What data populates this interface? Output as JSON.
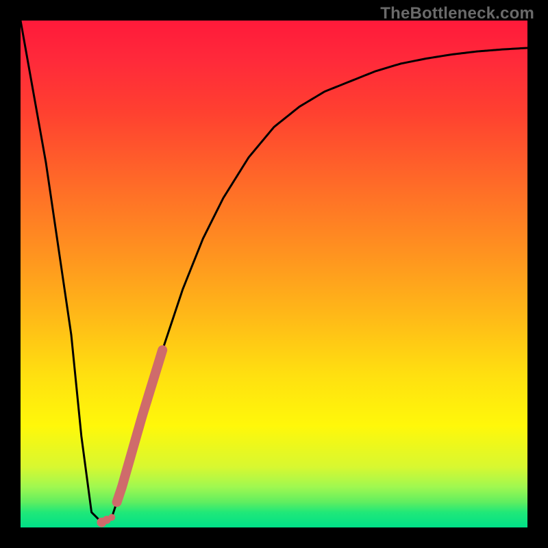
{
  "attribution": "TheBottleneck.com",
  "accent_colors": {
    "curve": "#000000",
    "marker": "#cf6b6b"
  },
  "chart_data": {
    "type": "line",
    "title": "",
    "xlabel": "",
    "ylabel": "",
    "xlim": [
      0,
      100
    ],
    "ylim": [
      0,
      100
    ],
    "series": [
      {
        "name": "bottleneck-curve",
        "x": [
          0,
          5,
          10,
          12,
          14,
          16,
          18,
          20,
          24,
          28,
          32,
          36,
          40,
          45,
          50,
          55,
          60,
          65,
          70,
          75,
          80,
          85,
          90,
          95,
          100
        ],
        "y": [
          100,
          72,
          38,
          18,
          3,
          1,
          2,
          8,
          22,
          35,
          47,
          57,
          65,
          73,
          79,
          83,
          86,
          88,
          90,
          91.5,
          92.5,
          93.3,
          93.9,
          94.3,
          94.6
        ]
      }
    ],
    "markers": [
      {
        "name": "highlight-band",
        "series": 0,
        "x_range": [
          19,
          28
        ],
        "style": "thick"
      },
      {
        "name": "dots",
        "series": 0,
        "x_points": [
          16,
          17,
          18
        ],
        "style": "dots"
      }
    ]
  }
}
